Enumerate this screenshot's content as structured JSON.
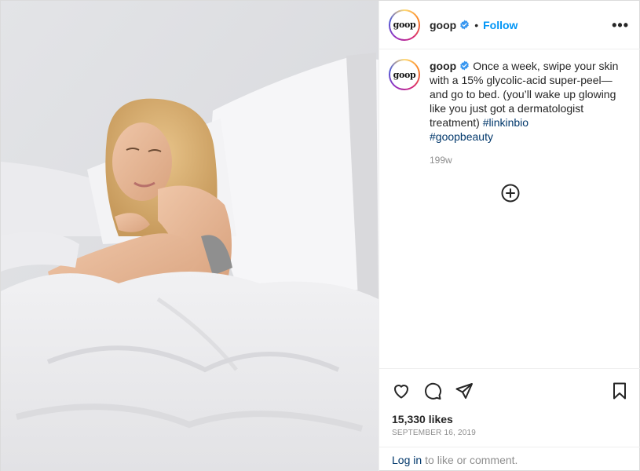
{
  "header": {
    "avatar_text": "goop",
    "username": "goop",
    "separator": "•",
    "follow_label": "Follow",
    "more_label": "•••"
  },
  "caption": {
    "username": "goop",
    "text": "Once a week, swipe your skin with a 15% glycolic-acid super-peel—and go to bed. (you’ll wake up glowing like you just got a dermatologist treatment) ",
    "hashtag_1": "#linkinbio",
    "hashtag_2": "#goopbeauty",
    "time_ago": "199w"
  },
  "actions": {
    "likes": "15,330 likes",
    "date": "SEPTEMBER 16, 2019"
  },
  "login": {
    "link_label": "Log in",
    "rest": "to like or comment."
  },
  "icons": {
    "verified": "verified-badge-icon",
    "plus": "plus-circle-icon",
    "like": "heart-icon",
    "comment": "comment-icon",
    "share": "paper-plane-icon",
    "save": "bookmark-icon",
    "more": "more-options-icon"
  },
  "colors": {
    "accent": "#0095f6",
    "verified": "#3897f0",
    "hashtag": "#00376b",
    "muted": "#8e8e8e"
  }
}
